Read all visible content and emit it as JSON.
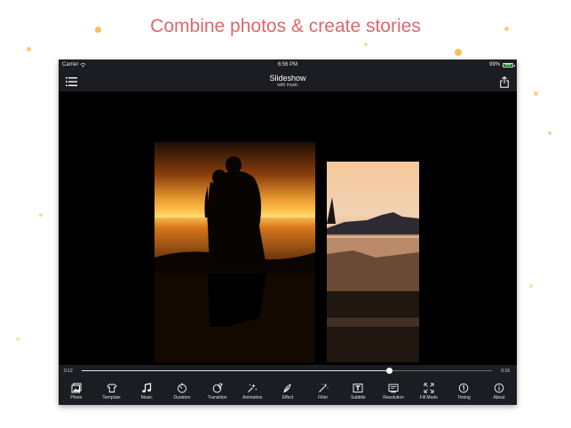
{
  "headline": "Combine photos & create stories",
  "status": {
    "carrier": "Carrier",
    "time": "6:56 PM",
    "battery": "99%",
    "battery_level": 0.99
  },
  "nav": {
    "title": "Slideshow",
    "subtitle": "with music"
  },
  "playback": {
    "current": "0:12",
    "total": "0:16",
    "progress": 0.75
  },
  "toolbar": [
    {
      "label": "Photo",
      "icon": "photo-icon"
    },
    {
      "label": "Template",
      "icon": "shirt-icon"
    },
    {
      "label": "Music",
      "icon": "music-note-icon"
    },
    {
      "label": "Duration",
      "icon": "timer-icon"
    },
    {
      "label": "Transition",
      "icon": "transition-icon"
    },
    {
      "label": "Animation",
      "icon": "animation-icon"
    },
    {
      "label": "Effect",
      "icon": "effect-icon"
    },
    {
      "label": "Filter",
      "icon": "magic-wand-icon"
    },
    {
      "label": "Subtitle",
      "icon": "text-icon"
    },
    {
      "label": "Resolution",
      "icon": "resolution-icon"
    },
    {
      "label": "Fill Mode",
      "icon": "fill-mode-icon"
    },
    {
      "label": "Timing",
      "icon": "timing-icon"
    },
    {
      "label": "About",
      "icon": "info-icon"
    }
  ],
  "colors": {
    "headline": "#e0666c",
    "bar": "#1c1d22",
    "accent_dots": "#f6c15a"
  }
}
